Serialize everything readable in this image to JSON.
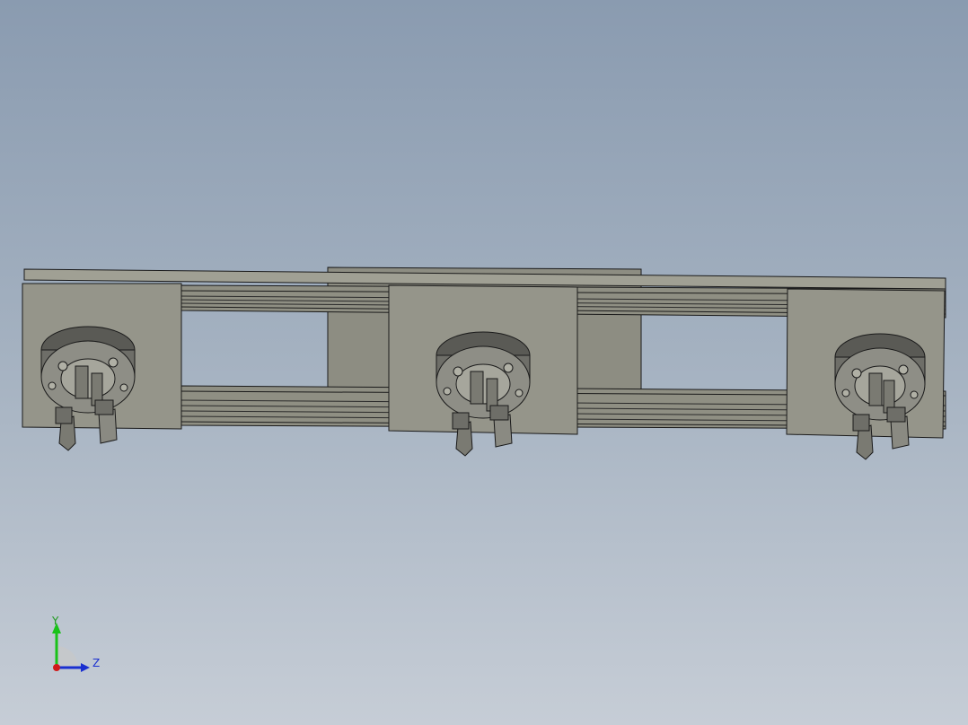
{
  "viewport": {
    "background_top": "#8a9bb0",
    "background_bottom": "#c6cdd6",
    "model_name": "",
    "parts": {
      "rail_color": "#8f8f83",
      "plate_color": "#95958a",
      "gripper_body_color": "#6e6e68",
      "edge_color": "#1a1a1a"
    },
    "gripper_count": 3
  },
  "triad": {
    "y_label": "Y",
    "z_label": "Z",
    "y_color": "#19c219",
    "z_color": "#1a2fd0",
    "x_color": "#d01a1a"
  }
}
